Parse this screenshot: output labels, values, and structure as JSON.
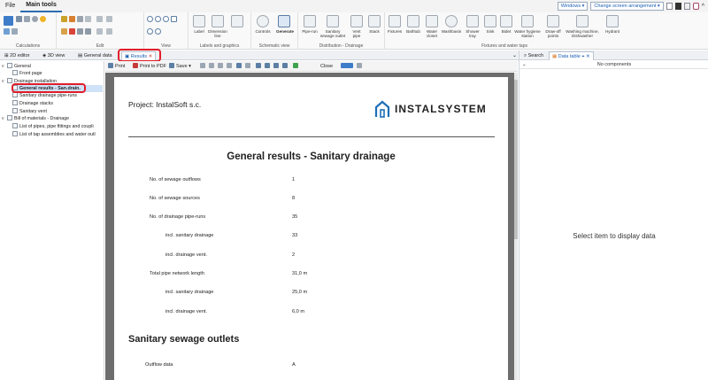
{
  "menu": {
    "items": [
      "File",
      "Main tools"
    ],
    "windows_label": "Windows",
    "arrangement_label": "Change screen arrangement"
  },
  "ribbon": {
    "groups": [
      {
        "caption": "Calculations",
        "buttons": []
      },
      {
        "caption": "Edit",
        "buttons": []
      },
      {
        "caption": "View",
        "buttons": []
      },
      {
        "caption": "Labels and graphics",
        "buttons": [
          "Label",
          "Dimension line",
          ""
        ]
      },
      {
        "caption": "Schematic view",
        "buttons": [
          "Controls",
          "Generate"
        ]
      },
      {
        "caption": "Distribution - Drainage",
        "buttons": [
          "Pipe-run",
          "Sanitary sewage outlet",
          "Vent pipe",
          "Stack"
        ]
      },
      {
        "caption": "Fixtures and water taps",
        "buttons": [
          "Fixtures",
          "Bathtub",
          "Water closet",
          "Washbasin",
          "Shower tray",
          "Sink",
          "Bidet",
          "Water hygiene station",
          "Draw-off points",
          "Washing machine, Dishwasher",
          "Hydrant"
        ]
      }
    ]
  },
  "tabs": {
    "items": [
      "2D editor",
      "3D view",
      "General data",
      "Results"
    ],
    "active": "Results"
  },
  "tree": {
    "nodes": [
      {
        "label": "General",
        "level": 0,
        "expander": "v"
      },
      {
        "label": "Front page",
        "level": 1,
        "expander": ""
      },
      {
        "label": "Drainage installation",
        "level": 0,
        "expander": "v"
      },
      {
        "label": "General results - San.drain.",
        "level": 1,
        "expander": ""
      },
      {
        "label": "Sanitary drainage pipe-runs",
        "level": 1,
        "expander": ""
      },
      {
        "label": "Drainage stacks",
        "level": 1,
        "expander": ""
      },
      {
        "label": "Sanitary vent",
        "level": 1,
        "expander": ""
      },
      {
        "label": "Bill of materials - Drainage",
        "level": 0,
        "expander": "v"
      },
      {
        "label": "List of pipes, pipe fittings and coupli",
        "level": 1,
        "expander": ""
      },
      {
        "label": "List of tap assemblies and water outl",
        "level": 1,
        "expander": ""
      }
    ]
  },
  "report_toolbar": {
    "print": "Print",
    "print_pdf": "Print to PDF",
    "save": "Save",
    "close": "Close"
  },
  "report": {
    "project": "Project: InstalSoft s.c.",
    "logo_text": "INSTALSYSTEM",
    "title": "General results - Sanitary drainage",
    "rows": [
      {
        "label": "No. of sewage outflows",
        "value": "1",
        "indent": false
      },
      {
        "label": "No. of sewage sources",
        "value": "8",
        "indent": false
      },
      {
        "label": "No. of drainage pipe-runs",
        "value": "35",
        "indent": false
      },
      {
        "label": "incl. sanitary drainage",
        "value": "33",
        "indent": true
      },
      {
        "label": "incl. drainage vent.",
        "value": "2",
        "indent": true
      },
      {
        "label": "Total pipe network length",
        "value": "31,0 m",
        "indent": false
      },
      {
        "label": "incl. sanitary drainage",
        "value": "25,0 m",
        "indent": true
      },
      {
        "label": "incl. drainage vent.",
        "value": "6,0 m",
        "indent": true
      }
    ],
    "section2": "Sanitary sewage outlets",
    "outflow_label": "Outflow data",
    "outflow_value": "A"
  },
  "right_panel": {
    "tabs": [
      "Search",
      "Data table"
    ],
    "header": "No components",
    "message": "Select item to display data"
  },
  "colors": {
    "accent": "#1a5fb4",
    "highlight": "#e11d2a",
    "selection": "#cfe2f7"
  }
}
